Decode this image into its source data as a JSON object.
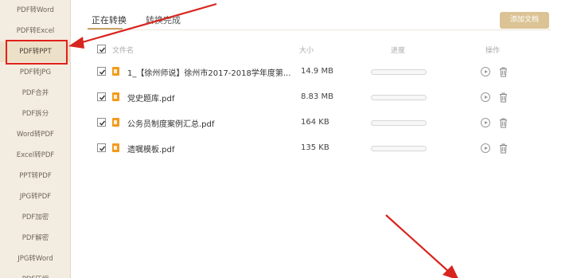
{
  "sidebar": {
    "items": [
      {
        "label": "PDF转Word"
      },
      {
        "label": "PDF转Excel"
      },
      {
        "label": "PDF转PPT",
        "active": true
      },
      {
        "label": "PDF转JPG"
      },
      {
        "label": "PDF合并"
      },
      {
        "label": "PDF拆分"
      },
      {
        "label": "Word转PDF"
      },
      {
        "label": "Excel转PDF"
      },
      {
        "label": "PPT转PDF"
      },
      {
        "label": "JPG转PDF"
      },
      {
        "label": "PDF加密"
      },
      {
        "label": "PDF解密"
      },
      {
        "label": "JPG转Word"
      },
      {
        "label": "PDF压缩"
      }
    ]
  },
  "tabs": {
    "converting": "正在转换",
    "completed": "转换完成"
  },
  "toolbar": {
    "add_files_label": "添加文档"
  },
  "table": {
    "headers": {
      "filename": "文件名",
      "size": "大小",
      "progress": "进度",
      "actions": "操作"
    },
    "rows": [
      {
        "name": "1_【徐州师说】徐州市2017-2018学年度第...",
        "size": "14.9 MB",
        "progress": 0,
        "checked": true
      },
      {
        "name": "党史题库.pdf",
        "size": "8.83 MB",
        "progress": 0,
        "checked": true
      },
      {
        "name": "公务员制度案例汇总.pdf",
        "size": "164 KB",
        "progress": 0,
        "checked": true
      },
      {
        "name": "遗嘱模板.pdf",
        "size": "135 KB",
        "progress": 0,
        "checked": true
      }
    ]
  },
  "colors": {
    "accent": "#dbc395",
    "highlight": "#e0211b",
    "file_icon": "#f29b1d",
    "sidebar_bg": "#f3ece1"
  }
}
